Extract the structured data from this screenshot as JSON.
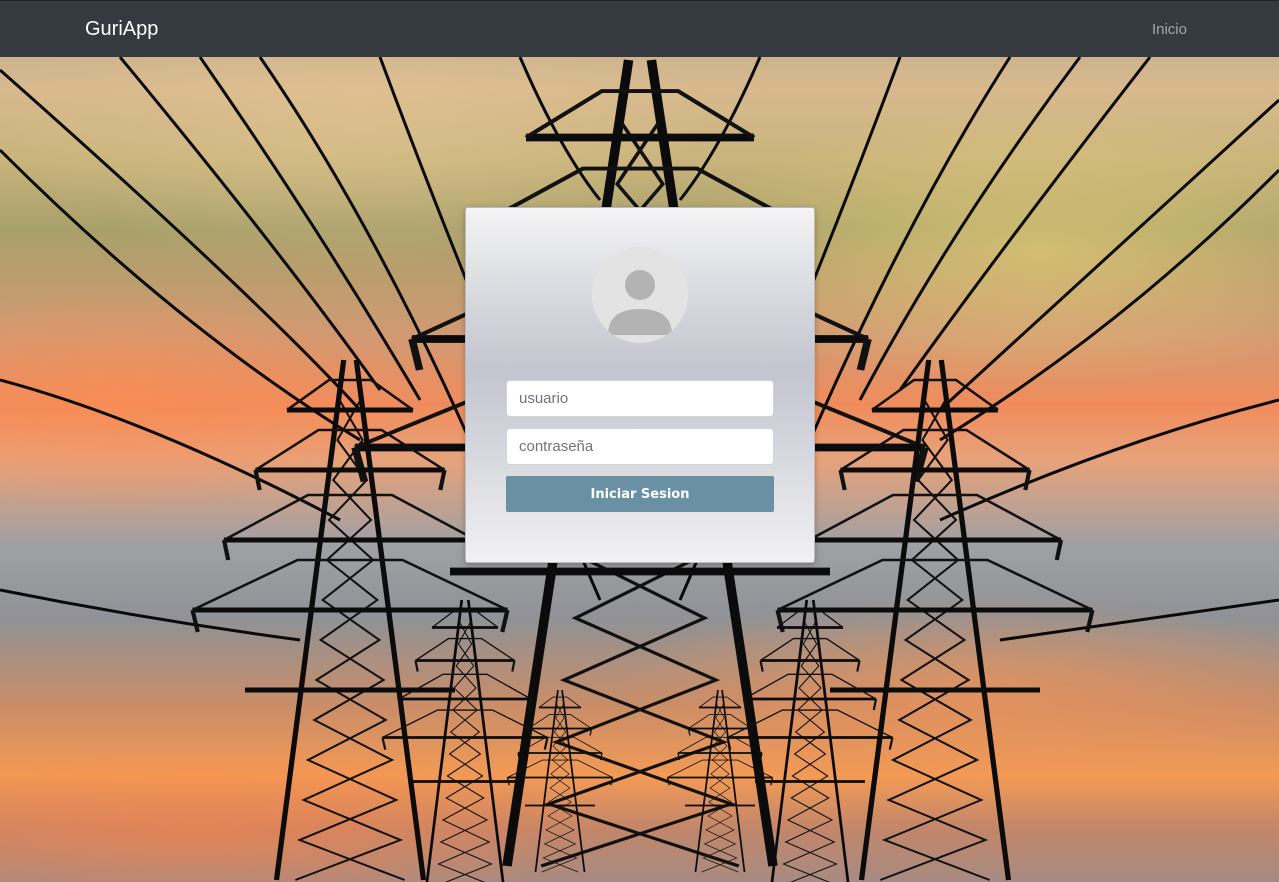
{
  "navbar": {
    "brand": "GuriApp",
    "links": [
      {
        "label": "Inicio"
      }
    ],
    "background": "#343a40"
  },
  "login": {
    "avatar_icon": "default-user-avatar-icon",
    "username_placeholder": "usuario",
    "username_value": "",
    "password_placeholder": "contraseña",
    "password_value": "",
    "submit_label": "Iniciar Sesion",
    "submit_color": "#6a91a3"
  },
  "background_image": "power-transmission-towers-at-sunset"
}
